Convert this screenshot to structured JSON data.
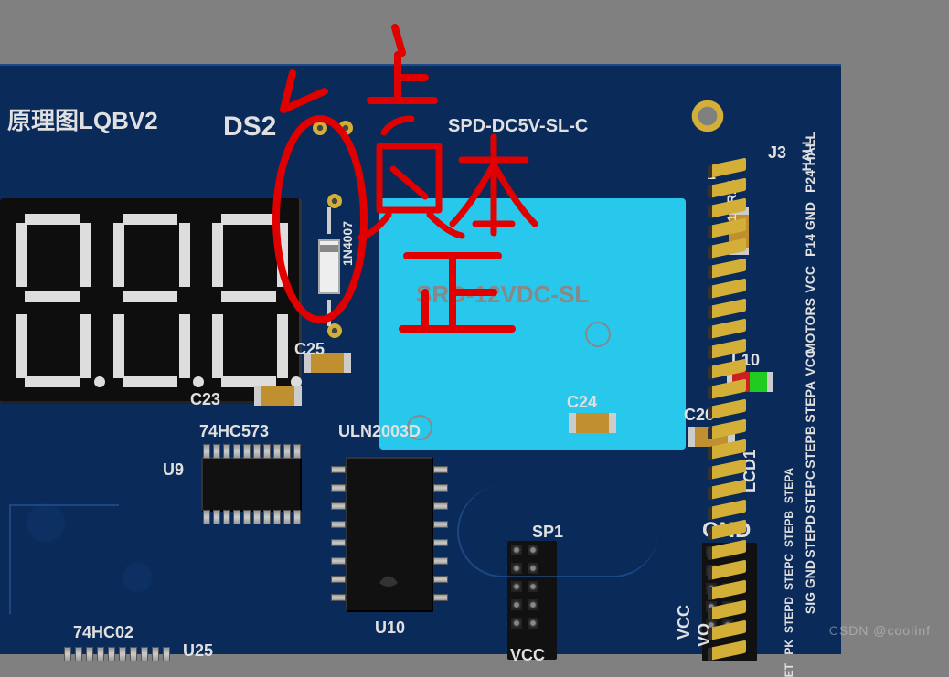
{
  "board": {
    "title": "原理图LQBV2",
    "silkscreen": {
      "ds2": "DS2",
      "spd": "SPD-DC5V-SL-C",
      "j3": "J3",
      "relay_text": "SRD-12VDC-SL",
      "c23": "C23",
      "c25": "C25",
      "c24": "C24",
      "c26": "C26",
      "l10": "L10",
      "r24": "1k R24",
      "ic573": "74HC573",
      "u9": "U9",
      "uln": "ULN2003D",
      "u10": "U10",
      "ic02": "74HC02",
      "u25": "U25",
      "sp1": "SP1",
      "vcc": "VCC",
      "vcc2": "VCC",
      "vo": "VO",
      "gnd": "GND",
      "lcd1": "LCD1",
      "diode": "1N4007",
      "num1": "1"
    },
    "pin_labels": [
      "HALL",
      "P24",
      "GND",
      "P14",
      "VCC",
      "MOTORS",
      "VCC",
      "STEPA",
      "STEPB",
      "STEPC",
      "STEPD",
      "GND",
      "SIG"
    ],
    "pin_labels2": [
      "",
      "",
      "",
      "",
      "",
      "",
      "",
      "STEPA",
      "STEPB",
      "STEPC",
      "STEPD",
      "PK",
      "ET"
    ]
  },
  "annotations": {
    "top": "上",
    "neg": "负",
    "pos": "正",
    "extra": "木"
  },
  "watermark": "CSDN @coolinf"
}
